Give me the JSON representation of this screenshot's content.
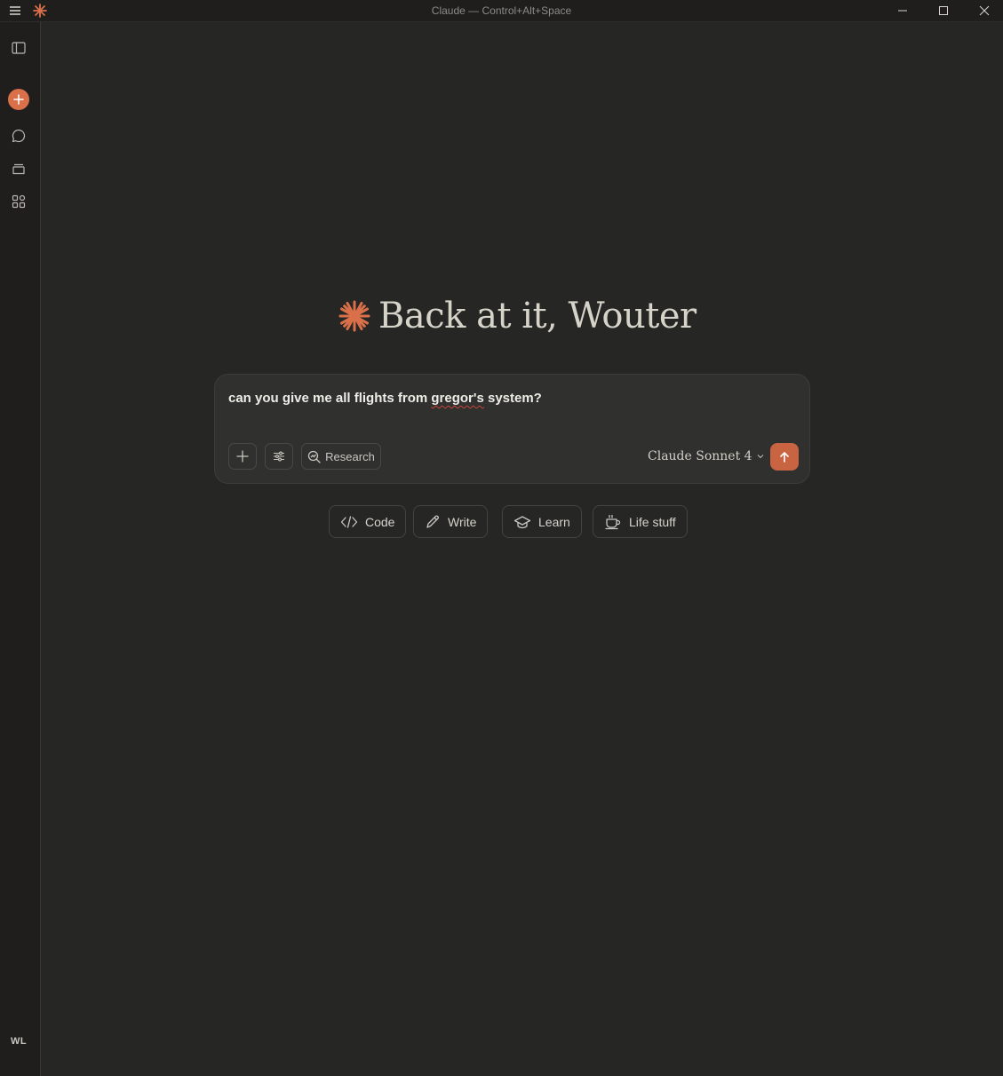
{
  "window": {
    "title": "Claude — Control+Alt+Space"
  },
  "sidebar": {
    "user_initials": "WL"
  },
  "greeting": {
    "text": "Back at it, Wouter"
  },
  "composer": {
    "prompt_before": "can you give me all flights from ",
    "prompt_misspelled": "gregor's",
    "prompt_after": " system?",
    "research_label": "Research",
    "model_label": "Claude Sonnet 4"
  },
  "chips": [
    {
      "label": "Code",
      "icon": "code-icon"
    },
    {
      "label": "Write",
      "icon": "pencil-icon"
    },
    {
      "label": "Learn",
      "icon": "graduation-cap-icon"
    },
    {
      "label": "Life stuff",
      "icon": "coffee-cup-icon"
    }
  ],
  "colors": {
    "background": "#262624",
    "sidebar": "#1f1e1d",
    "accent": "#d9704a",
    "send_button": "#c96442"
  }
}
